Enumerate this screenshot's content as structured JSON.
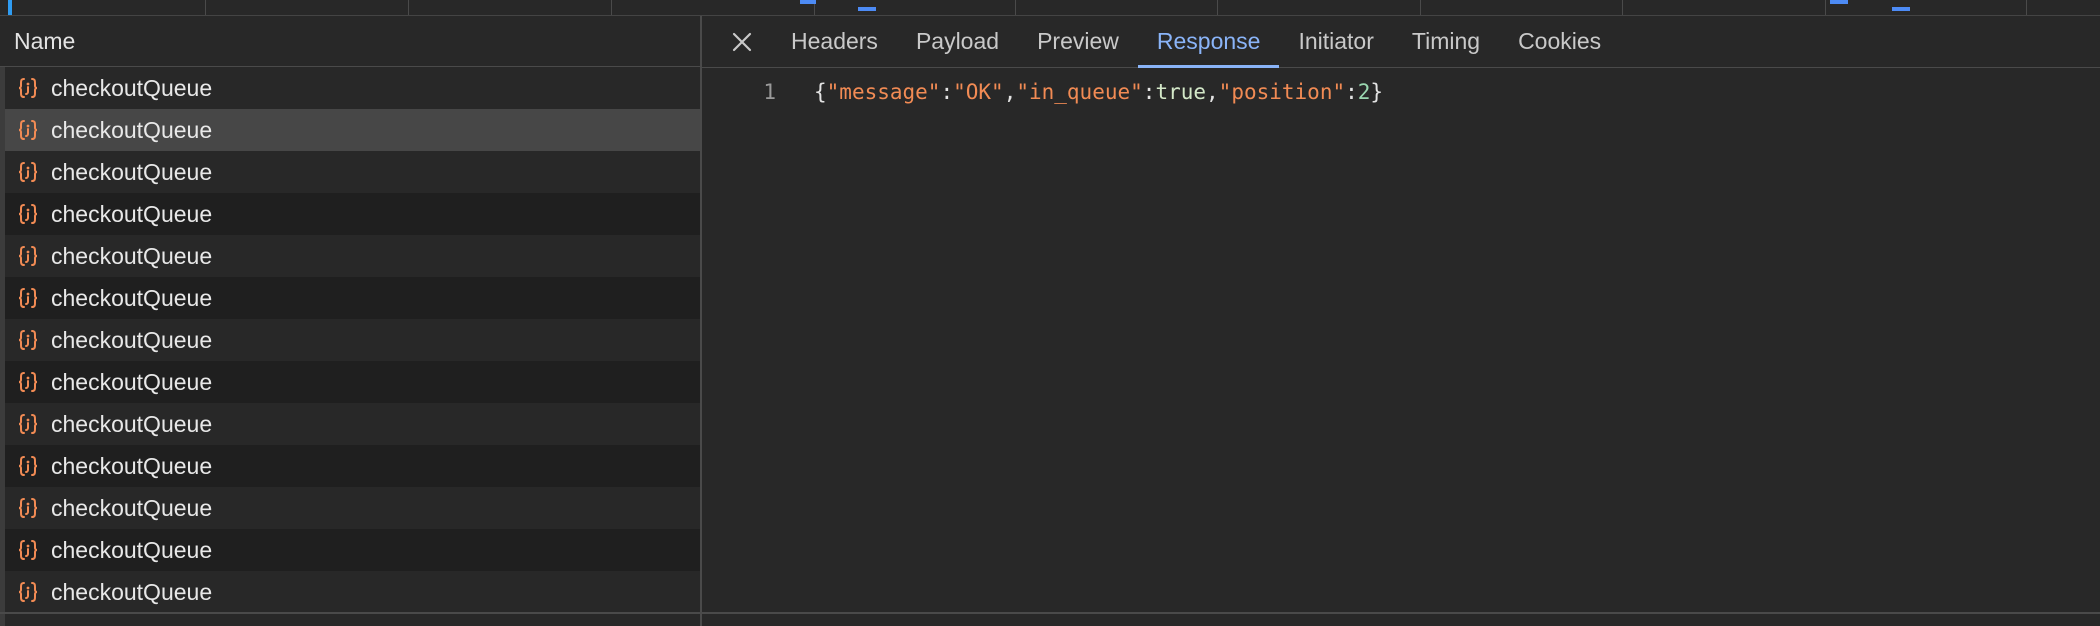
{
  "name_column": {
    "header": "Name",
    "rows": [
      {
        "label": "checkoutQueue",
        "icon": "json-braces-icon"
      },
      {
        "label": "checkoutQueue",
        "icon": "json-braces-icon"
      },
      {
        "label": "checkoutQueue",
        "icon": "json-braces-icon"
      },
      {
        "label": "checkoutQueue",
        "icon": "json-braces-icon"
      },
      {
        "label": "checkoutQueue",
        "icon": "json-braces-icon"
      },
      {
        "label": "checkoutQueue",
        "icon": "json-braces-icon"
      },
      {
        "label": "checkoutQueue",
        "icon": "json-braces-icon"
      },
      {
        "label": "checkoutQueue",
        "icon": "json-braces-icon"
      },
      {
        "label": "checkoutQueue",
        "icon": "json-braces-icon"
      },
      {
        "label": "checkoutQueue",
        "icon": "json-braces-icon"
      },
      {
        "label": "checkoutQueue",
        "icon": "json-braces-icon"
      },
      {
        "label": "checkoutQueue",
        "icon": "json-braces-icon"
      },
      {
        "label": "checkoutQueue",
        "icon": "json-braces-icon"
      }
    ],
    "selected_row": 1
  },
  "detail": {
    "close_icon": "close-icon",
    "tabs": [
      {
        "label": "Headers"
      },
      {
        "label": "Payload"
      },
      {
        "label": "Preview"
      },
      {
        "label": "Response"
      },
      {
        "label": "Initiator"
      },
      {
        "label": "Timing"
      },
      {
        "label": "Cookies"
      }
    ],
    "active_tab": 3,
    "response": {
      "line_number": "1",
      "open_brace": "{",
      "key_message": "\"message\"",
      "colon1": ":",
      "val_message": "\"OK\"",
      "comma1": ",",
      "key_in_queue": "\"in_queue\"",
      "colon2": ":",
      "val_in_queue": "true",
      "comma2": ",",
      "key_position": "\"position\"",
      "colon3": ":",
      "val_position": "2",
      "close_brace": "}"
    }
  },
  "colors": {
    "accent": "#8ab4f8",
    "json_icon": "#f28b54",
    "selected_row": "#474747"
  }
}
